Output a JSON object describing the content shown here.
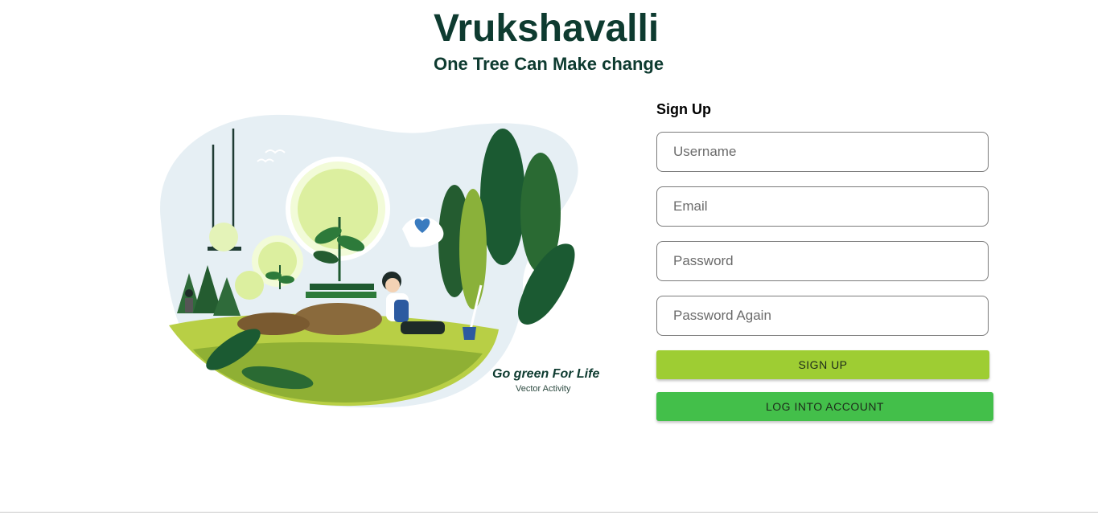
{
  "header": {
    "title": "Vrukshavalli",
    "subtitle": "One Tree Can Make change"
  },
  "illustration": {
    "tagline": "Go green For Life",
    "credit": "Vector Activity"
  },
  "signup_form": {
    "title": "Sign Up",
    "fields": {
      "username_placeholder": "Username",
      "email_placeholder": "Email",
      "password_placeholder": "Password",
      "password_again_placeholder": "Password Again"
    },
    "signup_button": "SIGN UP",
    "login_button": "LOG INTO ACCOUNT"
  },
  "colors": {
    "title_green": "#0e3b30",
    "signup_button": "#9ecd33",
    "login_button": "#43bf4a"
  }
}
